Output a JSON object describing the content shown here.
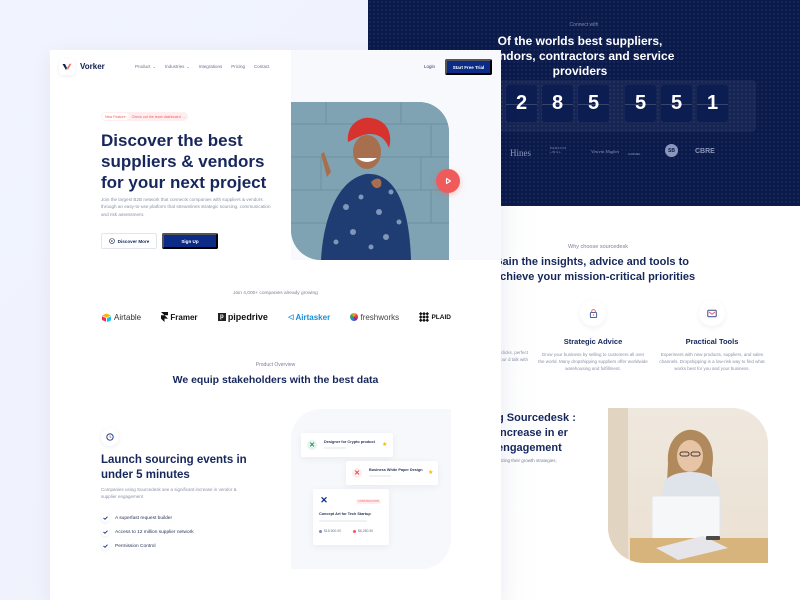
{
  "nav": {
    "brand": "Vorker",
    "links": [
      {
        "label": "Product",
        "dropdown": true
      },
      {
        "label": "Industries",
        "dropdown": true
      },
      {
        "label": "Integrations",
        "dropdown": false
      },
      {
        "label": "Pricing",
        "dropdown": false
      },
      {
        "label": "Contact",
        "dropdown": false
      }
    ],
    "login": "Login",
    "cta": "Start Free Trial"
  },
  "hero": {
    "badge_new": "New Feature",
    "badge_link": "Check out the team dashboard →",
    "title": "Discover the best suppliers & vendors for your next project",
    "description": "Join the largest B2B network that connects companies with suppliers & vendors through an easy-to-use platform that streamlines strategic sourcing, communication and risk assessment.",
    "discover_btn": "Discover More",
    "signup_btn": "Sign Up"
  },
  "clients": {
    "caption": "Join 4,000+ companies already growing",
    "logos": [
      "Airtable",
      "Framer",
      "pipedrive",
      "Airtasker",
      "freshworks",
      "PLAID"
    ]
  },
  "overview": {
    "eyebrow": "Product Overview",
    "title": "We equip stakeholders with the best data"
  },
  "feature": {
    "title": "Launch sourcing events in under 5 minutes",
    "description": "Companies using Sourcedesk see a significant increase in vendor & supplier engagement",
    "checklist": [
      "A superfast request builder",
      "Access to 12 million supplier network",
      "Permission Control"
    ]
  },
  "mockup": {
    "card1": "Designer for Crypto product",
    "card2": "Business White Paper Design",
    "card3_tag": "CONSTRUCTION",
    "card3_title": "Concept Art for Tech Startup",
    "price1": "$15,500.00",
    "price2": "$6,280.50"
  },
  "connect": {
    "eyebrow": "Connect with",
    "title": "Of the worlds best suppliers, vendors, contractors and service providers",
    "digits": [
      "2",
      "8",
      "5",
      "5",
      "5",
      "1"
    ],
    "partners": [
      "Hines",
      "PERKINS +WILL",
      "Vincent Hughes",
      "CARMEL",
      "SB",
      "CBRE"
    ]
  },
  "why": {
    "eyebrow": "Why choose sourcedesk",
    "title": "Gain the insights, advice and tools to achieve your mission-critical priorities",
    "cut_desc": "w clicks. perfect your d talk with",
    "features": [
      {
        "title": "Strategic Advice",
        "desc": "Grow your business by selling to customers all over the world. Many dropshipping suppliers offer worldwide warehousing and fulfillment."
      },
      {
        "title": "Practical Tools",
        "desc": "Experiment with new products, suppliers, and sales channels. Dropshipping is a low-risk way to find what works best for you and your business."
      }
    ]
  },
  "engage": {
    "title": "g Sourcedesk : increase in er engagement",
    "desc": "mizing their growth strategies,"
  },
  "colors": {
    "navy": "#0a1a4b",
    "primary": "#0b2b86",
    "accent": "#ef5b5b",
    "heading": "#16275c"
  }
}
